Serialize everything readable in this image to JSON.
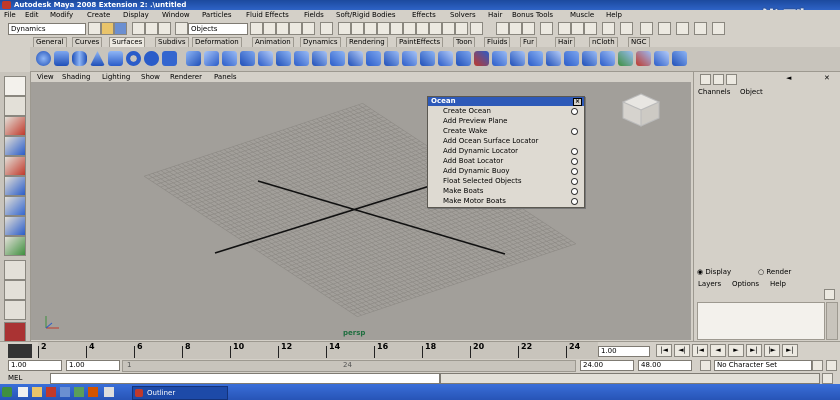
{
  "window": {
    "title": "Autodesk Maya 2008 Extension 2: .\\untitled"
  },
  "watermark": {
    "text": "优酷"
  },
  "menubar": [
    "File",
    "Edit",
    "Modify",
    "Create",
    "Display",
    "Window",
    "Particles",
    "Fluid Effects",
    "Fields",
    "Soft/Rigid Bodies",
    "Effects",
    "Solvers",
    "Hair",
    "Bonus Tools",
    "Muscle",
    "Help"
  ],
  "status": {
    "menuset": "Dynamics",
    "selection_mode": "Objects"
  },
  "shelf": {
    "tabs": [
      "General",
      "Curves",
      "Surfaces",
      "Subdivs",
      "Deformation",
      "Animation",
      "Dynamics",
      "Rendering",
      "PaintEffects",
      "Toon",
      "Fluids",
      "Fur",
      "Hair",
      "nCloth",
      "NGC"
    ],
    "active_tab": "Surfaces"
  },
  "panel_menu": [
    "View",
    "Shading",
    "Lighting",
    "Show",
    "Renderer",
    "Panels"
  ],
  "viewport": {
    "camera_label": "persp"
  },
  "ocean_menu": {
    "title": "Ocean",
    "items": [
      {
        "label": "Create Ocean",
        "has_options": true
      },
      {
        "label": "Add Preview Plane",
        "has_options": false
      },
      {
        "label": "Create Wake",
        "has_options": true
      },
      {
        "label": "Add Ocean Surface Locator",
        "has_options": true
      },
      {
        "label": "Add Dynamic Locator",
        "has_options": true
      },
      {
        "label": "Add Boat Locator",
        "has_options": true
      },
      {
        "label": "Add Dynamic Buoy",
        "has_options": true
      },
      {
        "label": "Float Selected Objects",
        "has_options": true
      },
      {
        "label": "Make Boats",
        "has_options": true
      },
      {
        "label": "Make Motor Boats",
        "has_options": true
      }
    ]
  },
  "channel_box": {
    "menu": [
      "Channels",
      "Object"
    ]
  },
  "layer_editor": {
    "radio_display": "Display",
    "radio_render": "Render",
    "menu": [
      "Layers",
      "Options",
      "Help"
    ]
  },
  "timeline": {
    "ticks": [
      "2",
      "4",
      "6",
      "8",
      "10",
      "12",
      "14",
      "16",
      "18",
      "20",
      "22",
      "24"
    ],
    "current_frame": "1.00"
  },
  "range": {
    "start": "1.00",
    "playback_start": "1.00",
    "slider_start": "1",
    "slider_end": "24",
    "playback_end": "24.00",
    "end": "48.00",
    "character_set": "No Character Set"
  },
  "command_line": {
    "label": "MEL"
  },
  "taskbar": {
    "item": "Outliner"
  }
}
